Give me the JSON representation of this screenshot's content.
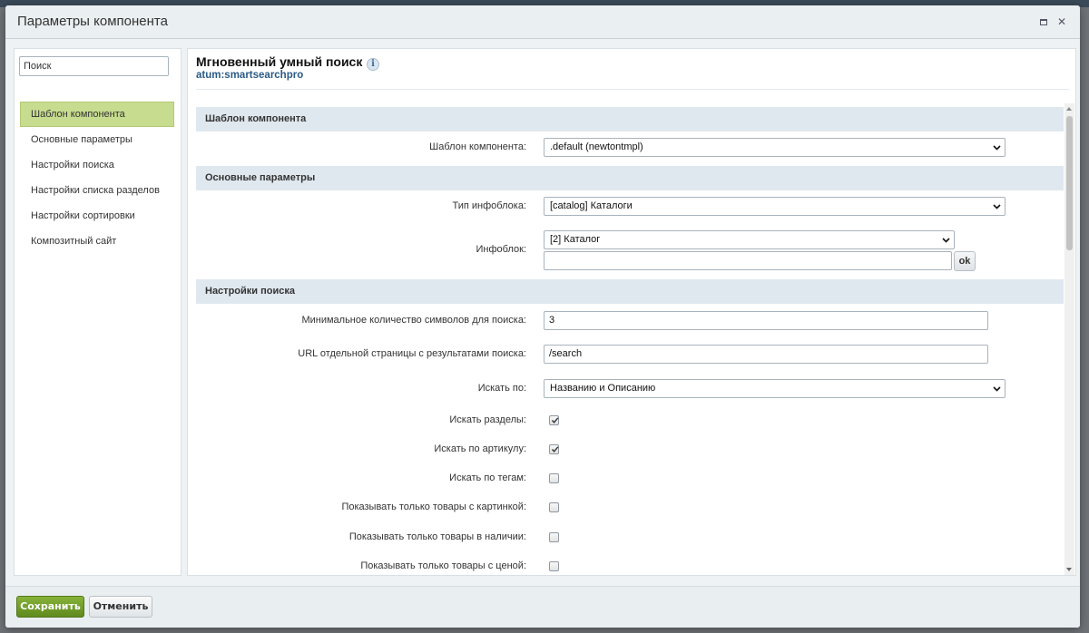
{
  "dialog": {
    "title": "Параметры компонента"
  },
  "sidebar": {
    "search_placeholder": "Поиск",
    "items": [
      {
        "label": "Шаблон компонента",
        "active": true
      },
      {
        "label": "Основные параметры"
      },
      {
        "label": "Настройки поиска"
      },
      {
        "label": "Настройки списка разделов"
      },
      {
        "label": "Настройки сортировки"
      },
      {
        "label": "Композитный сайт"
      }
    ]
  },
  "component": {
    "name": "Мгновенный умный поиск",
    "code": "atum:smartsearchpro"
  },
  "sections": {
    "template": {
      "title": "Шаблон компонента",
      "template_label": "Шаблон компонента:",
      "template_value": ".default (newtontmpl)"
    },
    "basic": {
      "title": "Основные параметры",
      "iblock_type_label": "Тип инфоблока:",
      "iblock_type_value": "[catalog] Каталоги",
      "iblock_label": "Инфоблок:",
      "iblock_value": "[2] Каталог",
      "iblock_input_value": "",
      "ok_label": "ok"
    },
    "search": {
      "title": "Настройки поиска",
      "min_chars_label": "Минимальное количество символов для поиска:",
      "min_chars_value": "3",
      "url_label": "URL отдельной страницы с результатами поиска:",
      "url_value": "/search",
      "search_by_label": "Искать по:",
      "search_by_value": "Названию и Описанию",
      "checkboxes": [
        {
          "label": "Искать разделы:",
          "checked": true
        },
        {
          "label": "Искать по артикулу:",
          "checked": true
        },
        {
          "label": "Искать по тегам:",
          "checked": false
        },
        {
          "label": "Показывать только товары с картинкой:",
          "checked": false
        },
        {
          "label": "Показывать только товары в наличии:",
          "checked": false
        },
        {
          "label": "Показывать только товары с ценой:",
          "checked": false
        }
      ]
    }
  },
  "footer": {
    "save_label": "Сохранить",
    "cancel_label": "Отменить"
  },
  "colors": {
    "accent_green": "#5f8a1d",
    "active_nav": "#c7dc8e",
    "section_header": "#e0e8ef"
  }
}
